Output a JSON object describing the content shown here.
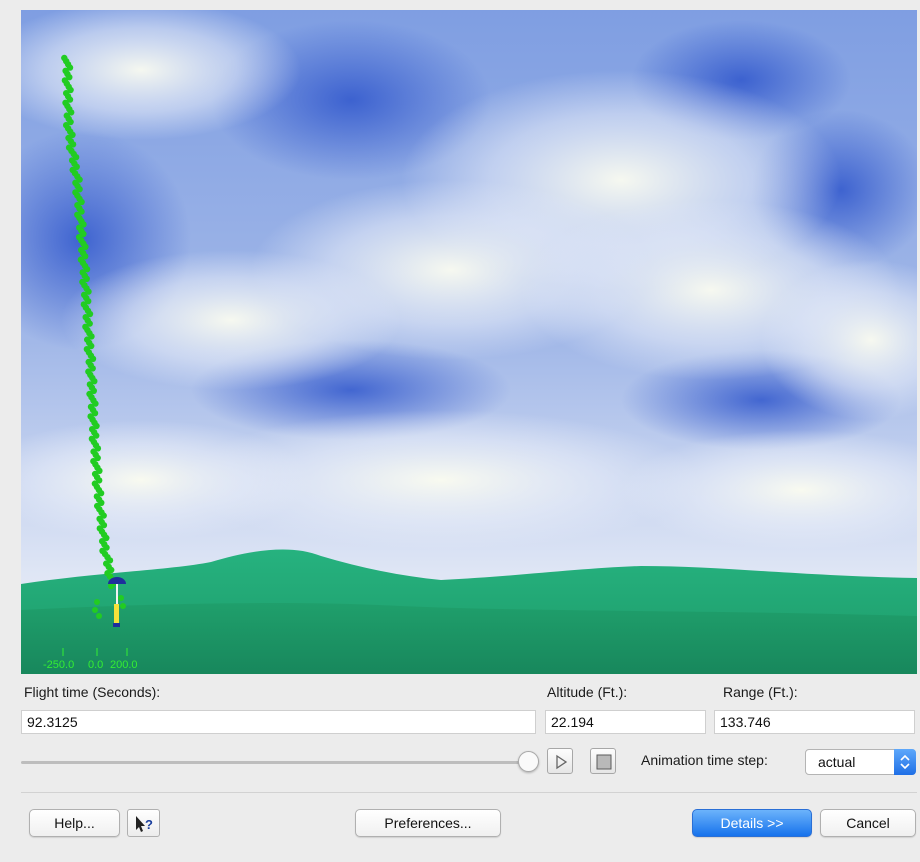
{
  "scene": {
    "ground_scale_ticks": [
      "-250.0",
      "0.0",
      "200.0"
    ]
  },
  "readouts": {
    "flight_time": {
      "label": "Flight time (Seconds):",
      "value": "92.3125"
    },
    "altitude": {
      "label": "Altitude (Ft.):",
      "value": "22.194"
    },
    "range": {
      "label": "Range (Ft.):",
      "value": "133.746"
    }
  },
  "playback": {
    "slider_position": 1.0,
    "play_icon": "play-icon",
    "stop_icon": "stop-icon",
    "time_step_label": "Animation time step:",
    "time_step_value": "actual"
  },
  "footer": {
    "help_label": "Help...",
    "whatsthis_icon": "whats-this-icon",
    "preferences_label": "Preferences...",
    "details_label": "Details >>",
    "cancel_label": "Cancel"
  },
  "colors": {
    "trail": "#22cc22",
    "ground": "#1f9e6a",
    "sky": "#5e86d8",
    "parachute": "#1e2f9c",
    "primary_button": "#1672ec"
  }
}
